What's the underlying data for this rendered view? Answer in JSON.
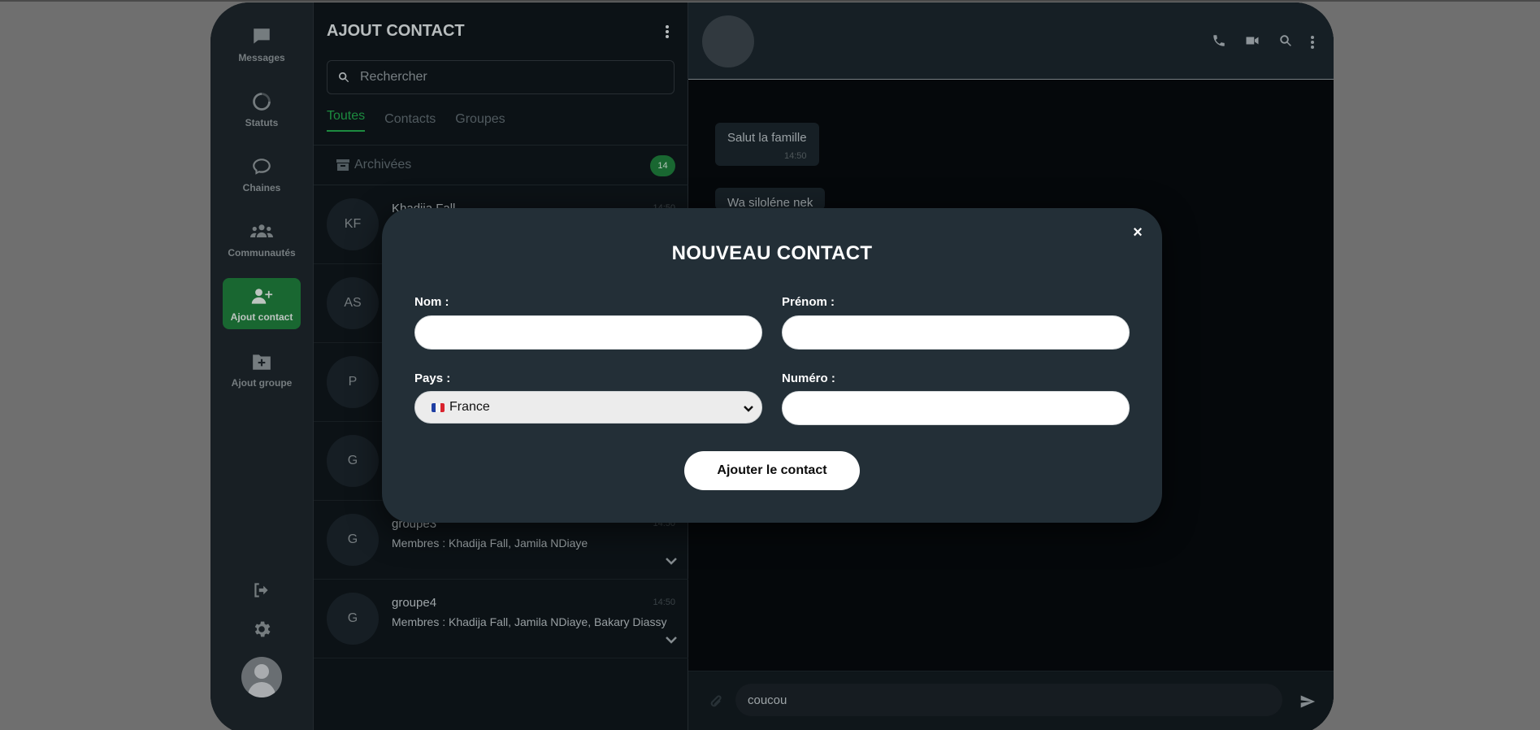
{
  "nav": {
    "items": [
      {
        "label": "Messages",
        "icon": "message-icon"
      },
      {
        "label": "Statuts",
        "icon": "status-icon"
      },
      {
        "label": "Chaines",
        "icon": "channel-icon"
      },
      {
        "label": "Communautés",
        "icon": "community-icon"
      },
      {
        "label": "Ajout contact",
        "icon": "add-contact-icon",
        "active": true
      },
      {
        "label": "Ajout groupe",
        "icon": "add-group-icon"
      }
    ]
  },
  "list": {
    "title": "AJOUT CONTACT",
    "search_placeholder": "Rechercher",
    "tabs": [
      "Toutes",
      "Contacts",
      "Groupes"
    ],
    "active_tab": "Toutes",
    "archive_label": "Archivées",
    "archive_count": "14",
    "rows": [
      {
        "avatar": "KF",
        "name": "Khadija Fall",
        "time": "14:50",
        "sub": ""
      },
      {
        "avatar": "AS",
        "name": "",
        "time": "",
        "sub": ""
      },
      {
        "avatar": "P",
        "name": "",
        "time": "",
        "sub": ""
      },
      {
        "avatar": "G",
        "name": "",
        "time": "",
        "sub": ""
      },
      {
        "avatar": "G",
        "name": "groupe3",
        "time": "14:50",
        "sub": "Membres : Khadija Fall, Jamila NDiaye"
      },
      {
        "avatar": "G",
        "name": "groupe4",
        "time": "14:50",
        "sub": "Membres : Khadija Fall, Jamila NDiaye, Bakary Diassy"
      }
    ]
  },
  "chat": {
    "messages": [
      {
        "text": "Salut la famille",
        "time": "14:50"
      },
      {
        "text": "Wa siloléne nek",
        "time": ""
      }
    ],
    "composer_text": "coucou"
  },
  "modal": {
    "title": "NOUVEAU CONTACT",
    "close_label": "×",
    "nom_label": "Nom :",
    "prenom_label": "Prénom :",
    "pays_label": "Pays :",
    "numero_label": "Numéro :",
    "pays_value": "France",
    "submit_label": "Ajouter le contact"
  },
  "colors": {
    "accent": "#1e7a3a",
    "tab_active": "#21a44a",
    "modal_bg": "#232f37"
  }
}
